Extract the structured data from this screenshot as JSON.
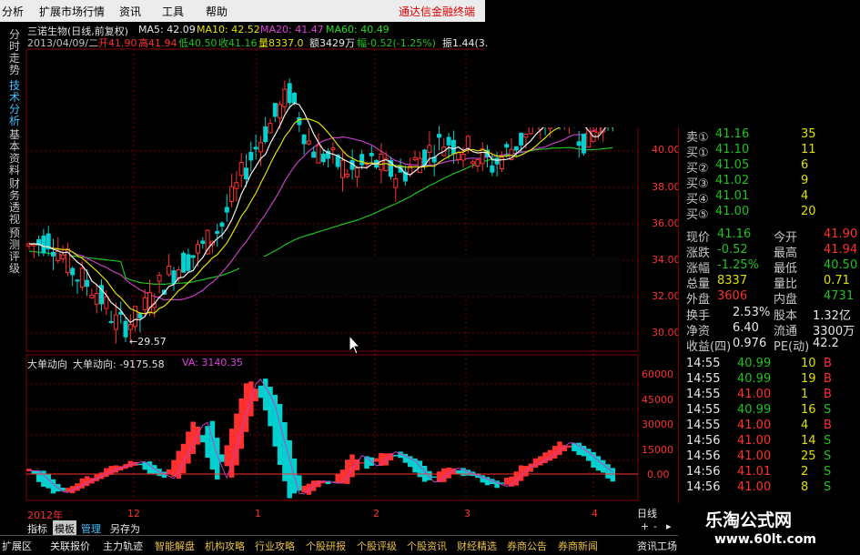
{
  "menu": {
    "items": [
      "分析",
      "扩展市场行情",
      "资讯",
      "工具",
      "帮助"
    ],
    "brand": "通达信金融终端"
  },
  "left_tabs": [
    "分时走势",
    "技术分析",
    "基本资料",
    "财务透视",
    "预测评级"
  ],
  "header": {
    "stock": "三诺生物(日线,前复权)",
    "ma5": "MA5: 42.09",
    "ma10": "MA10: 42.52",
    "ma20": "MA20: 41.47",
    "ma60": "MA60: 40.49",
    "date": "2013/04/09/二",
    "open": "开41.90",
    "high": "高41.94",
    "low": "低40.50",
    "close": "收41.16",
    "vol": "量8337.0",
    "amount": "额3429万",
    "change": "幅-0.52(-1.25%)",
    "amp": "振1.44(3."
  },
  "price_axis": [
    "40.00",
    "38.00",
    "36.00",
    "34.00",
    "32.00",
    "30.00"
  ],
  "low_label": "←29.57",
  "indicator": {
    "name": "大单动向",
    "value": "大单动向: -9175.58",
    "va": "VA: 3140.35"
  },
  "indicator_axis": [
    "60000",
    "45000",
    "30000",
    "15000",
    "0.00"
  ],
  "x_labels": [
    "2012年",
    "12",
    "1",
    "2",
    "3",
    "4"
  ],
  "quote_book": [
    {
      "label": "卖①",
      "price": "41.16",
      "vol": "35"
    },
    {
      "label": "买①",
      "price": "41.10",
      "vol": "11"
    },
    {
      "label": "买②",
      "price": "41.05",
      "vol": "6"
    },
    {
      "label": "买③",
      "price": "41.02",
      "vol": "9"
    },
    {
      "label": "买④",
      "price": "41.01",
      "vol": "4"
    },
    {
      "label": "买⑤",
      "price": "41.00",
      "vol": "20"
    }
  ],
  "stats": [
    {
      "l1": "现价",
      "v1": "41.16",
      "c1": "green",
      "l2": "今开",
      "v2": "41.90",
      "c2": "red"
    },
    {
      "l1": "涨跌",
      "v1": "-0.52",
      "c1": "green",
      "l2": "最高",
      "v2": "41.94",
      "c2": "red"
    },
    {
      "l1": "涨幅",
      "v1": "-1.25%",
      "c1": "green",
      "l2": "最低",
      "v2": "40.50",
      "c2": "green"
    },
    {
      "l1": "总量",
      "v1": "8337",
      "c1": "yellow",
      "l2": "量比",
      "v2": "0.71",
      "c2": "yellow"
    },
    {
      "l1": "外盘",
      "v1": "3606",
      "c1": "red",
      "l2": "内盘",
      "v2": "4731",
      "c2": "green"
    }
  ],
  "stats2": [
    {
      "l1": "换手",
      "v1": "2.53%",
      "l2": "股本",
      "v2": "1.32亿"
    },
    {
      "l1": "净资",
      "v1": "6.40",
      "l2": "流通",
      "v2": "3300万"
    },
    {
      "l1": "收益(四)",
      "v1": "0.976",
      "l2": "PE(动)",
      "v2": "42.2"
    }
  ],
  "ticks": [
    {
      "t": "14:55",
      "p": "40.99",
      "v": "10",
      "s": "B"
    },
    {
      "t": "14:55",
      "p": "40.99",
      "v": "19",
      "s": "B"
    },
    {
      "t": "14:55",
      "p": "41.00",
      "v": "1",
      "s": "B"
    },
    {
      "t": "14:55",
      "p": "40.99",
      "v": "16",
      "s": "S"
    },
    {
      "t": "14:55",
      "p": "41.00",
      "v": "4",
      "s": "B"
    },
    {
      "t": "14:56",
      "p": "41.00",
      "v": "14",
      "s": "S"
    },
    {
      "t": "14:56",
      "p": "41.00",
      "v": "25",
      "s": "S"
    },
    {
      "t": "14:56",
      "p": "41.01",
      "v": "2",
      "s": "S"
    },
    {
      "t": "14:56",
      "p": "41.00",
      "v": "8",
      "s": "S"
    }
  ],
  "chart_tabs": [
    "指标",
    "模板",
    "管理",
    "另存为"
  ],
  "period": "日线",
  "bottom_buttons": [
    "扩展区",
    "关联报价",
    "主力轨迹",
    "智能解盘",
    "机构攻略",
    "行业攻略",
    "个股研报",
    "个股评级",
    "个股资讯",
    "财经精选",
    "券商公告",
    "券商新闻",
    "资讯工场"
  ],
  "watermark": {
    "title": "乐淘公式网",
    "url": "www.60lt.com"
  },
  "colors": {
    "up": "#ff3030",
    "down": "#00d0d0",
    "ma5": "#f0f0f0",
    "ma10": "#e0e000",
    "ma20": "#c040c0",
    "ma60": "#20c020",
    "grid": "#800000"
  }
}
